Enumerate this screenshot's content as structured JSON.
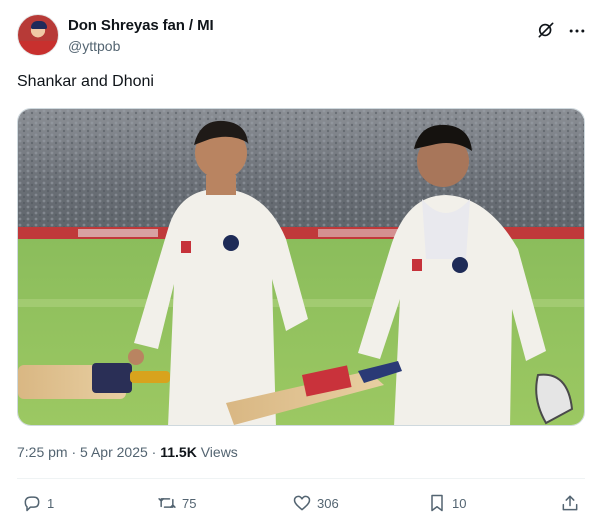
{
  "author": {
    "display_name": "Don Shreyas fan / MI",
    "handle": "@yttpob"
  },
  "post": {
    "text": "Shankar and Dhoni",
    "media_label": "Two cricketers in white kit walking off the field with bats"
  },
  "meta": {
    "time": "7:25 pm",
    "separator": " · ",
    "date": "5 Apr 2025",
    "views_count": "11.5K",
    "views_label": " Views"
  },
  "actions": {
    "replies": "1",
    "reposts": "75",
    "likes": "306",
    "bookmarks": "10"
  },
  "icons": {
    "grok": "grok-icon",
    "more": "more-icon",
    "reply": "reply-icon",
    "repost": "repost-icon",
    "like": "heart-icon",
    "bookmark": "bookmark-icon",
    "share": "share-icon"
  },
  "colors": {
    "text": "#0f1419",
    "secondary": "#536471",
    "border": "#cfd9de"
  }
}
